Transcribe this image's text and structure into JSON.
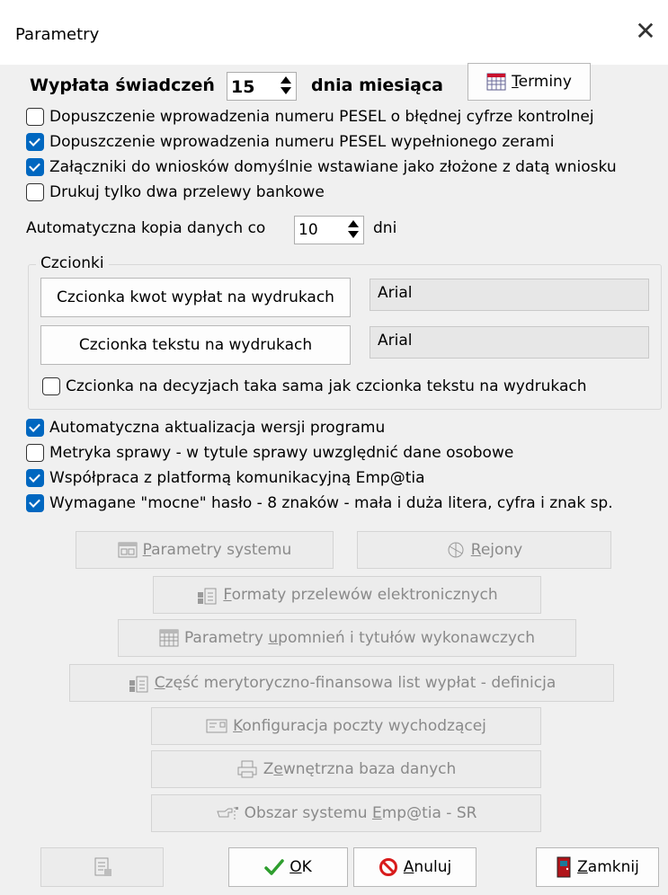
{
  "window": {
    "title": "Parametry"
  },
  "payout": {
    "label_before": "Wypłata świadczeń",
    "day_value": "15",
    "label_after": "dnia miesiąca",
    "terminy_button": {
      "underline": "T",
      "rest": "erminy"
    }
  },
  "options_top": [
    {
      "label": "Dopuszczenie wprowadzenia numeru PESEL o błędnej cyfrze kontrolnej",
      "checked": false
    },
    {
      "label": "Dopuszczenie wprowadzenia numeru PESEL wypełnionego zerami",
      "checked": true
    },
    {
      "label": "Załączniki do wniosków domyślnie wstawiane jako złożone z datą wniosku",
      "checked": true
    },
    {
      "label": "Drukuj tylko dwa przelewy bankowe",
      "checked": false
    }
  ],
  "backup": {
    "label_before": "Automatyczna kopia danych co",
    "value": "10",
    "label_after": "dni"
  },
  "fonts": {
    "legend": "Czcionki",
    "amount_button": "Czcionka kwot wypłat na wydrukach",
    "amount_value": "Arial",
    "text_button": "Czcionka tekstu na wydrukach",
    "text_value": "Arial",
    "same_font": {
      "label": "Czcionka na decyzjach taka sama jak czcionka tekstu na wydrukach",
      "checked": false
    }
  },
  "options_bottom": [
    {
      "label": "Automatyczna aktualizacja wersji programu",
      "checked": true
    },
    {
      "label": "Metryka sprawy - w tytule sprawy uwzględnić dane osobowe",
      "checked": false
    },
    {
      "label": "Współpraca z platformą komunikacyjną Emp@tia",
      "checked": true
    },
    {
      "label": "Wymagane \"mocne\" hasło - 8 znaków - mała i duża litera, cyfra i znak sp.",
      "checked": true
    }
  ],
  "actions": {
    "system_params": {
      "underline": "P",
      "rest": "arametry systemu"
    },
    "regions": {
      "underline": "R",
      "rest": "ejony"
    },
    "transfer_formats": {
      "underline": "F",
      "rest": "ormaty przelewów elektronicznych"
    },
    "reminder_params": {
      "before": "Parametry ",
      "underline": "u",
      "rest": "pomnień i tytułów wykonawczych"
    },
    "payroll_part": {
      "underline": "C",
      "rest": "zęść merytoryczno-finansowa list wypłat - definicja"
    },
    "mail_config": {
      "underline": "K",
      "rest": "onfiguracja poczty wychodzącej"
    },
    "external_db": {
      "before": "Z",
      "underline": "e",
      "rest": "wnętrzna baza danych"
    },
    "empatia_area": {
      "before": "Obszar systemu ",
      "underline": "E",
      "rest": "mp@tia - SR"
    }
  },
  "footer": {
    "ok": {
      "underline": "O",
      "rest": "K"
    },
    "cancel": {
      "underline": "A",
      "rest": "nuluj"
    },
    "close": {
      "underline": "Z",
      "rest": "amknij"
    }
  },
  "colors": {
    "accent": "#0067c0",
    "ok_check": "#2e9e2e",
    "cancel_red": "#d81b1b",
    "close_door": "#b0141a"
  }
}
